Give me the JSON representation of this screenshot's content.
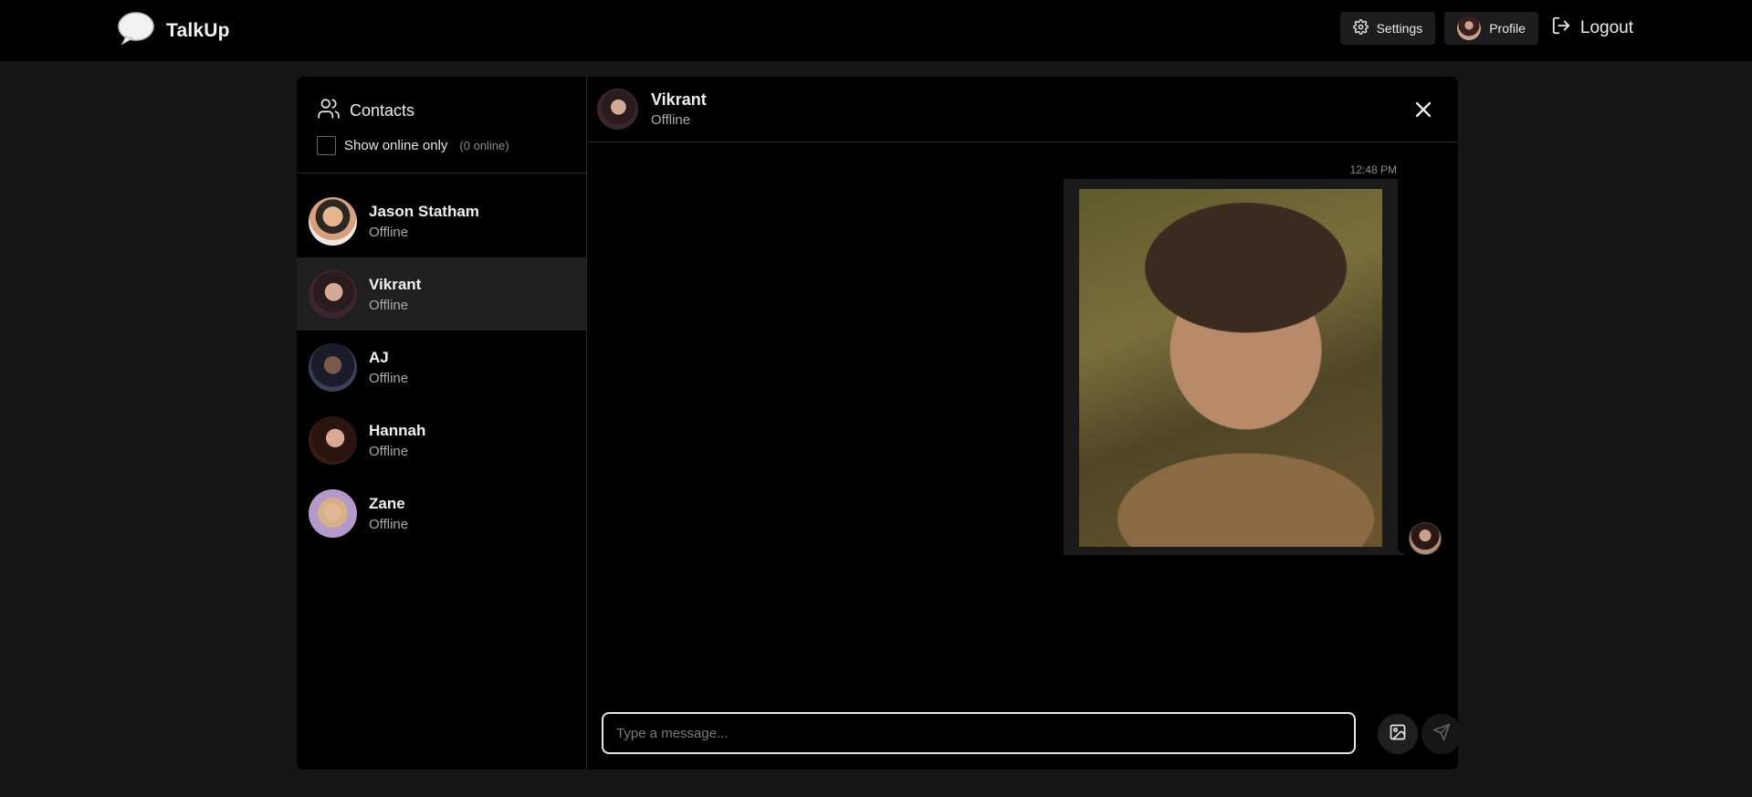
{
  "app": {
    "name": "TalkUp"
  },
  "nav": {
    "settings_label": "Settings",
    "profile_label": "Profile",
    "logout_label": "Logout"
  },
  "sidebar": {
    "title": "Contacts",
    "online_filter_label": "Show online only",
    "online_count": "(0 online)",
    "contacts": [
      {
        "name": "Jason Statham",
        "status": "Offline"
      },
      {
        "name": "Vikrant",
        "status": "Offline"
      },
      {
        "name": "AJ",
        "status": "Offline"
      },
      {
        "name": "Hannah",
        "status": "Offline"
      },
      {
        "name": "Zane",
        "status": "Offline"
      }
    ]
  },
  "chat": {
    "contact_name": "Vikrant",
    "contact_status": "Offline",
    "messages": [
      {
        "time": "12:48 PM",
        "type": "image"
      }
    ],
    "input_placeholder": "Type a message..."
  },
  "colors": {
    "background": "#151515",
    "panel": "#000000",
    "active_contact": "#1f1f1f",
    "bubble": "#1a1a1a"
  },
  "icons": [
    "chat-bubble-icon",
    "gear-icon",
    "logout-icon",
    "users-icon",
    "close-icon",
    "image-icon",
    "send-icon"
  ]
}
